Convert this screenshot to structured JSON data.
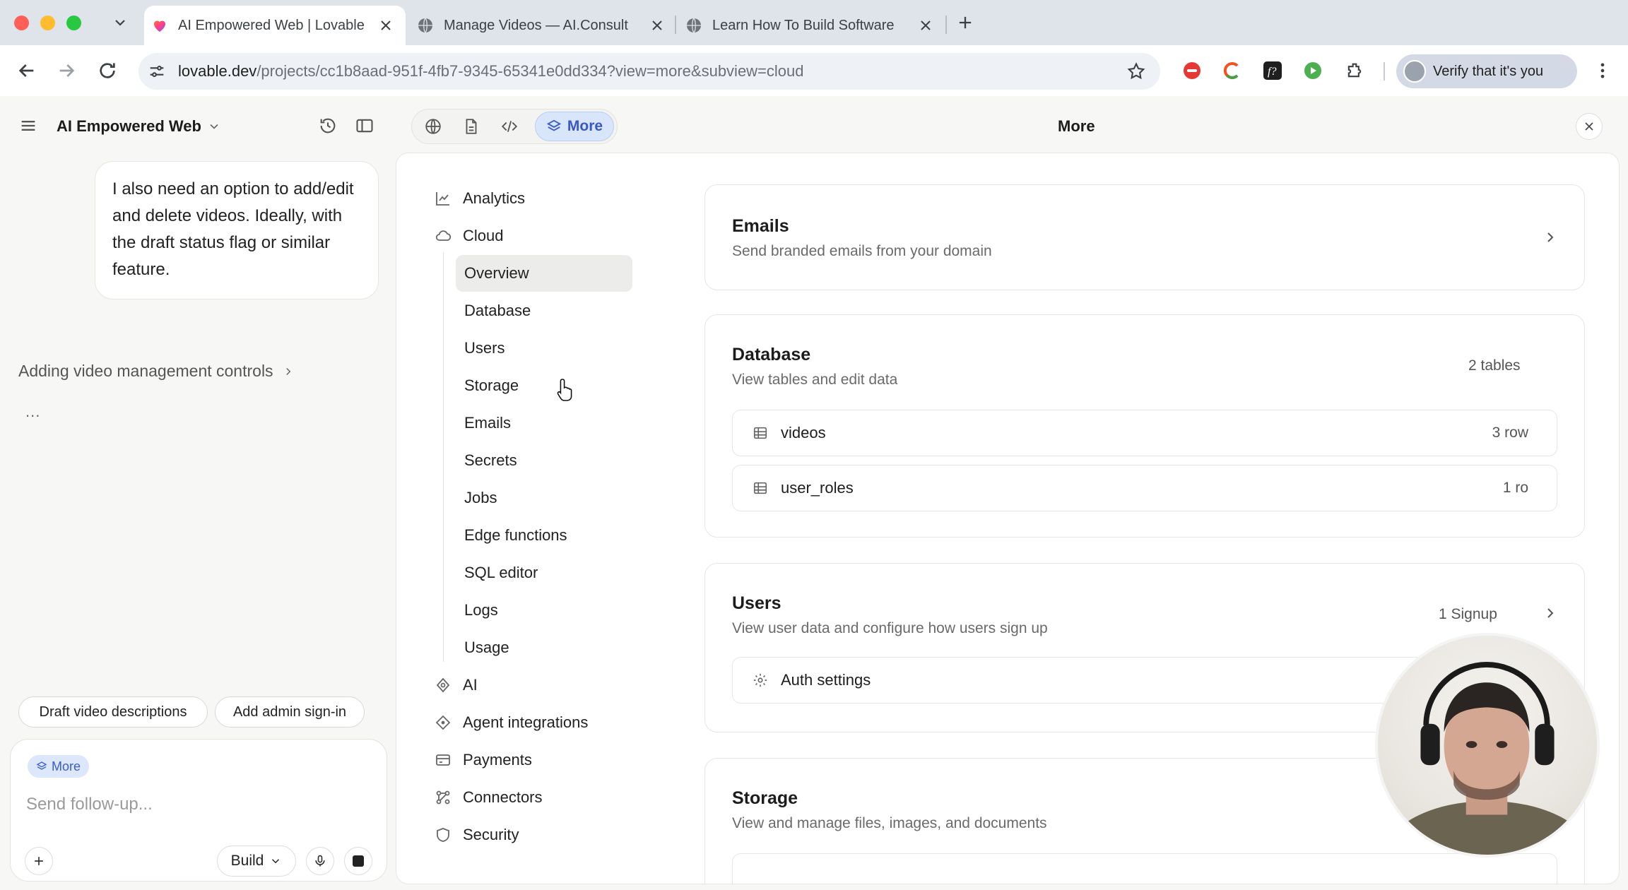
{
  "browser": {
    "tabs": [
      {
        "title": "AI Empowered Web | Lovable",
        "active": true
      },
      {
        "title": "Manage Videos — AI.Consult",
        "active": false
      },
      {
        "title": "Learn How To Build Software",
        "active": false
      }
    ],
    "url_host": "lovable.dev",
    "url_rest": "/projects/cc1b8aad-951f-4fb7-9345-65341e0dd334?view=more&subview=cloud",
    "profile_label": "Verify that it's you",
    "colors": {
      "chrome_bg": "#dfe3ea",
      "close": "#ff5f57",
      "min": "#febc2e",
      "max": "#28c840"
    }
  },
  "left": {
    "project_name": "AI Empowered Web",
    "message": "I also need an option to add/edit and delete videos. Ideally, with the draft status flag or similar feature.",
    "step_link": "Adding video management controls",
    "ellipsis": "...",
    "suggestions": [
      "Draft video descriptions",
      "Add admin sign-in"
    ],
    "composer": {
      "chip_label": "More",
      "placeholder": "Send follow-up...",
      "mode_label": "Build"
    }
  },
  "panel": {
    "toggle_active_label": "More",
    "title": "More",
    "nav": {
      "analytics": "Analytics",
      "cloud": "Cloud",
      "cloud_sub": [
        "Overview",
        "Database",
        "Users",
        "Storage",
        "Emails",
        "Secrets",
        "Jobs",
        "Edge functions",
        "SQL editor",
        "Logs",
        "Usage"
      ],
      "ai": "AI",
      "agent_integrations": "Agent integrations",
      "payments": "Payments",
      "connectors": "Connectors",
      "security": "Security"
    },
    "cards": {
      "emails": {
        "title": "Emails",
        "subtitle": "Send branded emails from your domain"
      },
      "database": {
        "title": "Database",
        "subtitle": "View tables and edit data",
        "meta": "2 tables",
        "rows": [
          {
            "name": "videos",
            "count": "3 row"
          },
          {
            "name": "user_roles",
            "count": "1 ro"
          }
        ]
      },
      "users": {
        "title": "Users",
        "subtitle": "View user data and configure how users sign up",
        "meta": "1 Signup",
        "row": "Auth settings"
      },
      "storage": {
        "title": "Storage",
        "subtitle": "View and manage files, images, and documents"
      }
    },
    "accent": "#3858c8"
  }
}
